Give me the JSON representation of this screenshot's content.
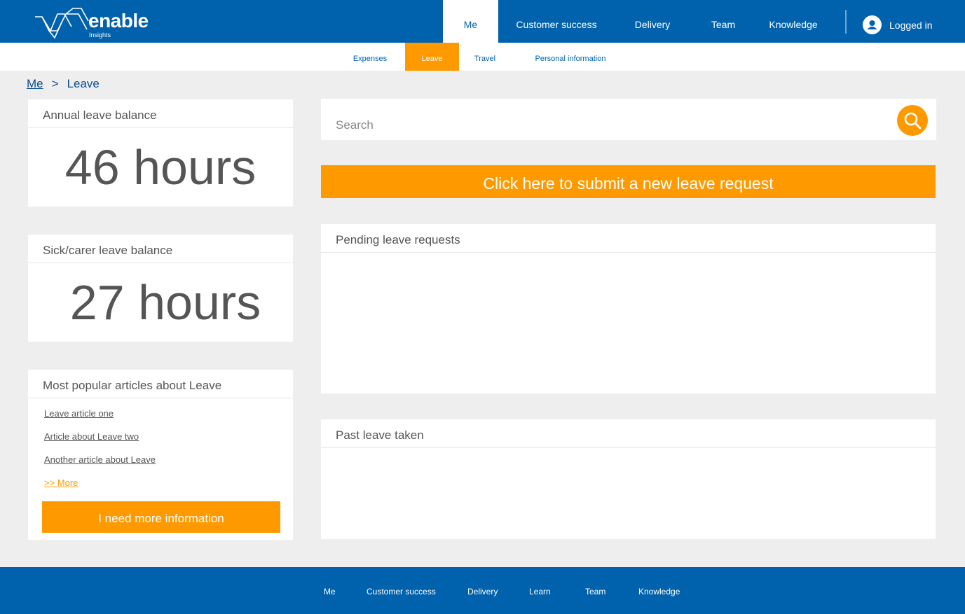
{
  "header": {
    "logo_text": "enable",
    "logo_sub": "Insights",
    "nav": [
      "Me",
      "Customer success",
      "Delivery",
      "Team",
      "Knowledge"
    ],
    "active_nav": "Me",
    "login_label": "Logged in"
  },
  "subnav": {
    "items": [
      "Expenses",
      "Leave",
      "Travel",
      "Personal information"
    ],
    "active": "Leave"
  },
  "breadcrumb": {
    "parent": "Me",
    "separator": ">",
    "current": "Leave"
  },
  "annual": {
    "title": "Annual leave balance",
    "value": "46 hours"
  },
  "sick": {
    "title": "Sick/carer leave balance",
    "value": "27 hours"
  },
  "articles": {
    "title": "Most popular articles about Leave",
    "links": [
      "Leave article one",
      "Article about Leave two",
      "Another article about Leave"
    ],
    "more": ">> More",
    "button": "I need more information"
  },
  "search": {
    "placeholder": "Search"
  },
  "submit_button": "Click here to submit a new leave request",
  "pending": {
    "title": "Pending leave requests"
  },
  "past": {
    "title": "Past leave taken"
  },
  "footer": {
    "nav": [
      "Me",
      "Customer success",
      "Delivery",
      "Learn",
      "Team",
      "Knowledge"
    ]
  },
  "colors": {
    "brand_blue": "#0061ad",
    "accent_orange": "#ff9900",
    "background": "#eeeeee"
  },
  "icons": {
    "logo": "enable-logo-icon",
    "user": "user-icon",
    "search": "search-icon"
  }
}
